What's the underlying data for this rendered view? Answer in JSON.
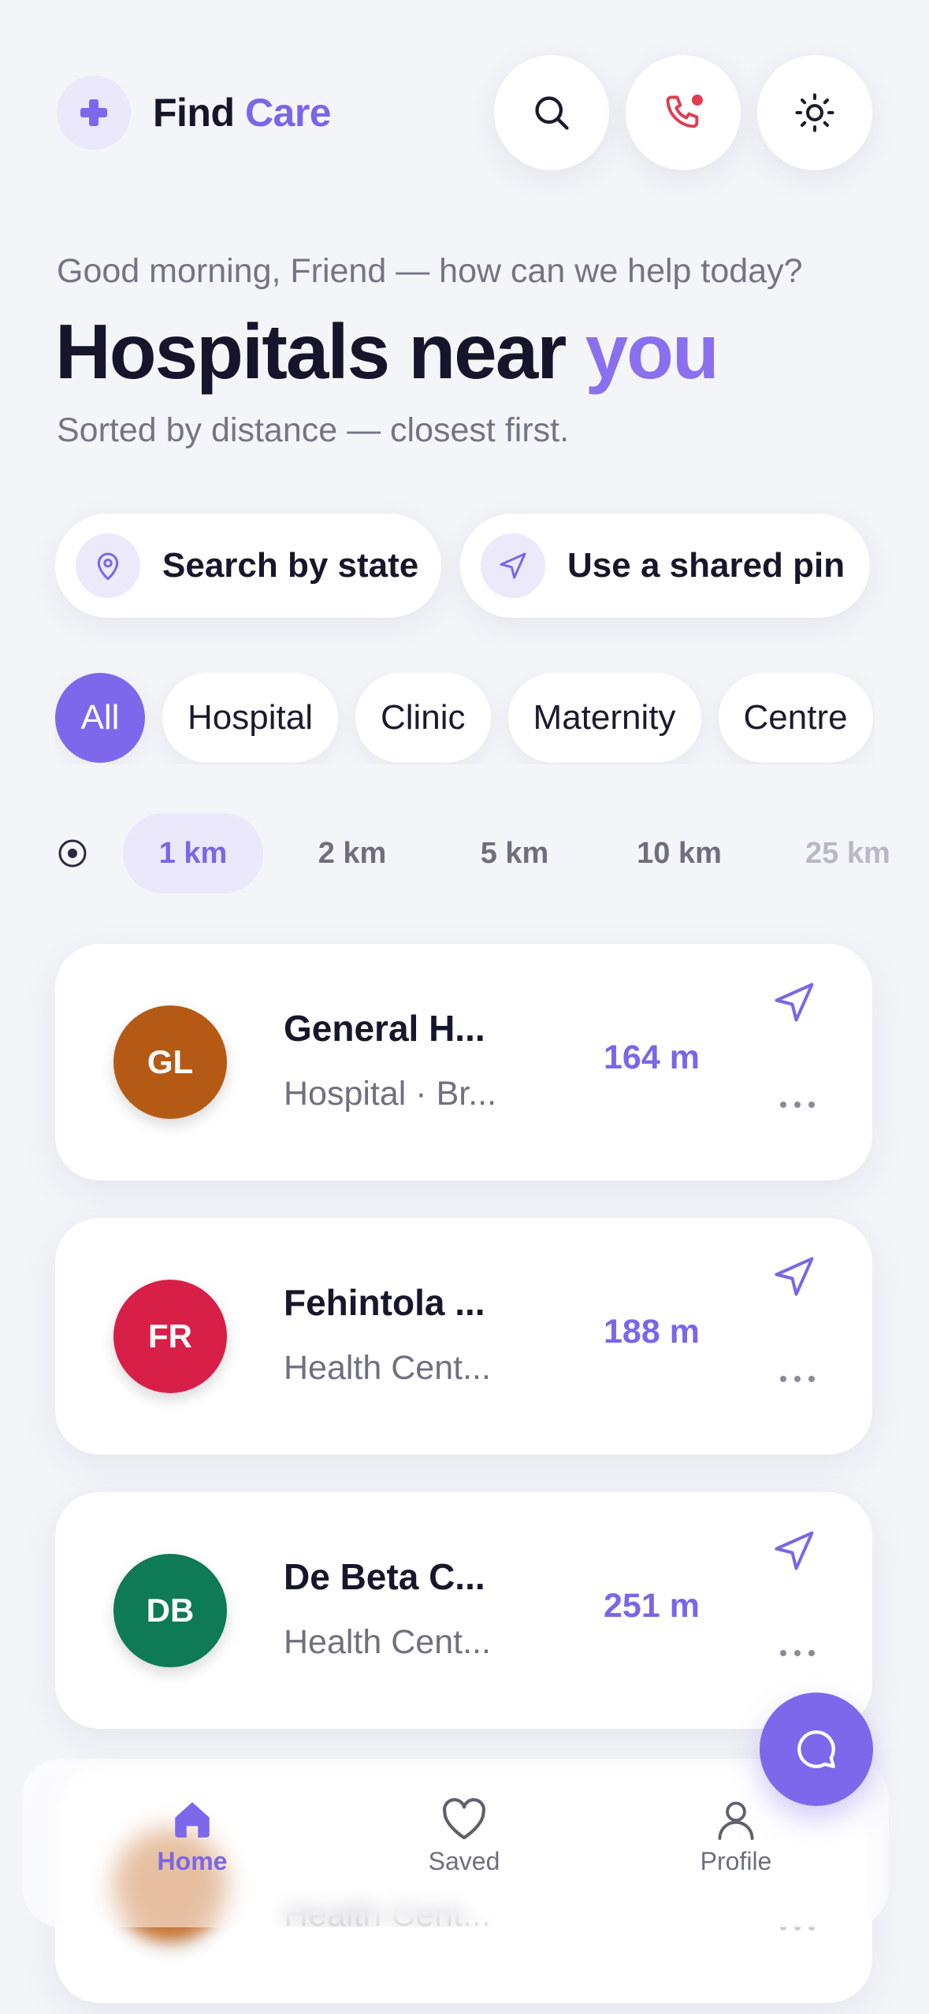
{
  "header": {
    "brand_first": "Find",
    "brand_accent": "Care",
    "icons": [
      "plus-icon",
      "search-icon",
      "phone-call-icon",
      "sun-icon"
    ]
  },
  "hero": {
    "greeting": "Good morning, Friend — how can we help today?",
    "title_main": "Hospitals near",
    "title_accent": "you",
    "subtitle": "Sorted by distance — closest first."
  },
  "actions": {
    "search_state": "Search by state",
    "shared_pin": "Use a shared pin"
  },
  "categories": {
    "selected": "All",
    "items": [
      "All",
      "Hospital",
      "Clinic",
      "Maternity",
      "Centre"
    ]
  },
  "radius": {
    "selected": "1 km",
    "items": [
      "1 km",
      "2 km",
      "5 km",
      "10 km",
      "25 km"
    ]
  },
  "hospitals": [
    {
      "initials": "GL",
      "name": "General H...",
      "subtitle": "Hospital · Br...",
      "distance": "164 m",
      "color": "#b55a15"
    },
    {
      "initials": "FR",
      "name": "Fehintola ...",
      "subtitle": "Health Cent...",
      "distance": "188 m",
      "color": "#d81f47"
    },
    {
      "initials": "DB",
      "name": "De Beta C...",
      "subtitle": "Health Cent...",
      "distance": "251 m",
      "color": "#0e7a56"
    },
    {
      "initials": "",
      "name": "",
      "subtitle": "Health Cent...",
      "distance": "",
      "color": "#c2641a"
    }
  ],
  "nav": {
    "home": "Home",
    "saved": "Saved",
    "profile": "Profile",
    "active": "Home"
  },
  "colors": {
    "accent": "#7d68ec",
    "background": "#f4f5f9",
    "call_red": "#e23b4f"
  }
}
